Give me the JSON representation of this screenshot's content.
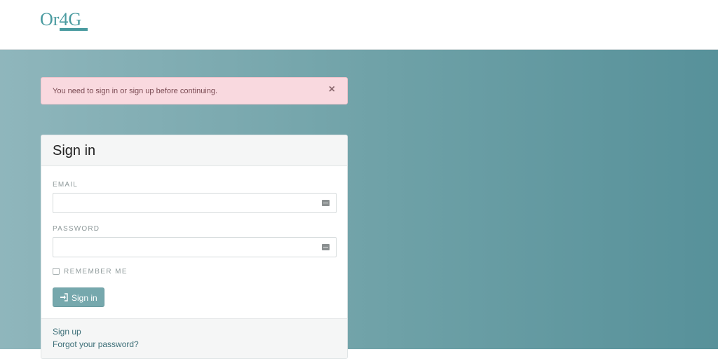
{
  "header": {
    "logo_text": "Or4G"
  },
  "alert": {
    "message": "You need to sign in or sign up before continuing.",
    "close_glyph": "×"
  },
  "signin": {
    "title": "Sign in",
    "email_label": "EMAIL",
    "email_value": "",
    "password_label": "PASSWORD",
    "password_value": "",
    "remember_label": "REMEMBER ME",
    "remember_checked": false,
    "submit_label": "Sign in",
    "submit_icon": "sign-in-icon",
    "field_icon": "autofill-card-icon"
  },
  "links": {
    "sign_up": "Sign up",
    "forgot_password": "Forgot your password?"
  },
  "colors": {
    "brand": "#4a9ba0",
    "alert_bg": "#f9d9df",
    "button_bg": "#76a8ad"
  }
}
